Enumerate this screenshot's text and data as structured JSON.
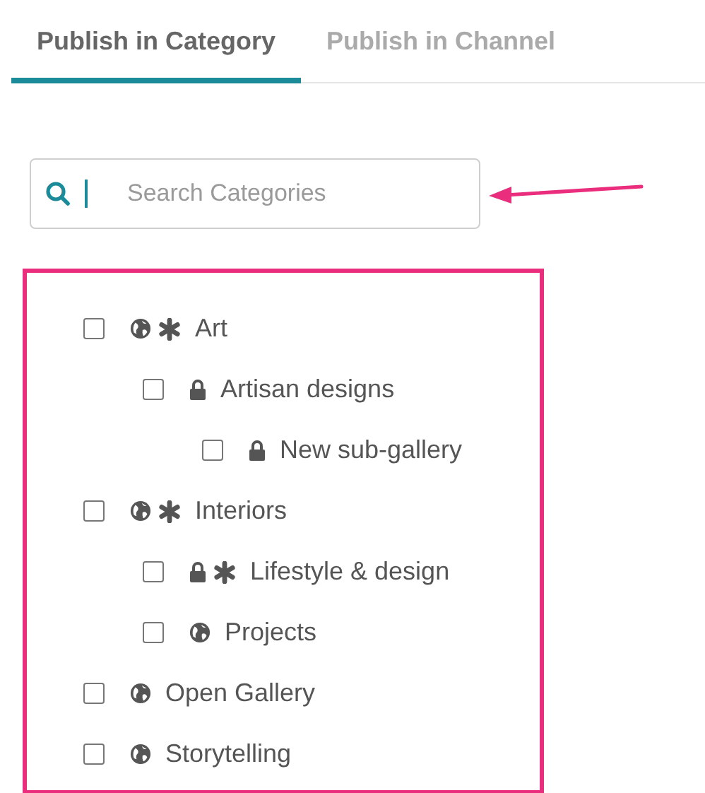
{
  "tabs": [
    {
      "label": "Publish in Category",
      "selected": true
    },
    {
      "label": "Publish in Channel",
      "selected": false
    }
  ],
  "search": {
    "placeholder": "Search Categories"
  },
  "categories": [
    {
      "label": "Art",
      "checked": false,
      "locked": false,
      "featured": true,
      "children": [
        {
          "label": "Artisan designs",
          "checked": false,
          "locked": true,
          "featured": false,
          "children": [
            {
              "label": "New sub-gallery",
              "checked": false,
              "locked": true,
              "featured": false
            }
          ]
        }
      ]
    },
    {
      "label": "Interiors",
      "checked": false,
      "locked": false,
      "featured": true,
      "children": [
        {
          "label": "Lifestyle & design",
          "checked": false,
          "locked": true,
          "featured": true
        },
        {
          "label": "Projects",
          "checked": false,
          "locked": false,
          "featured": false
        }
      ]
    },
    {
      "label": "Open Gallery",
      "checked": false,
      "locked": false,
      "featured": false
    },
    {
      "label": "Storytelling",
      "checked": false,
      "locked": false,
      "featured": false
    }
  ]
}
